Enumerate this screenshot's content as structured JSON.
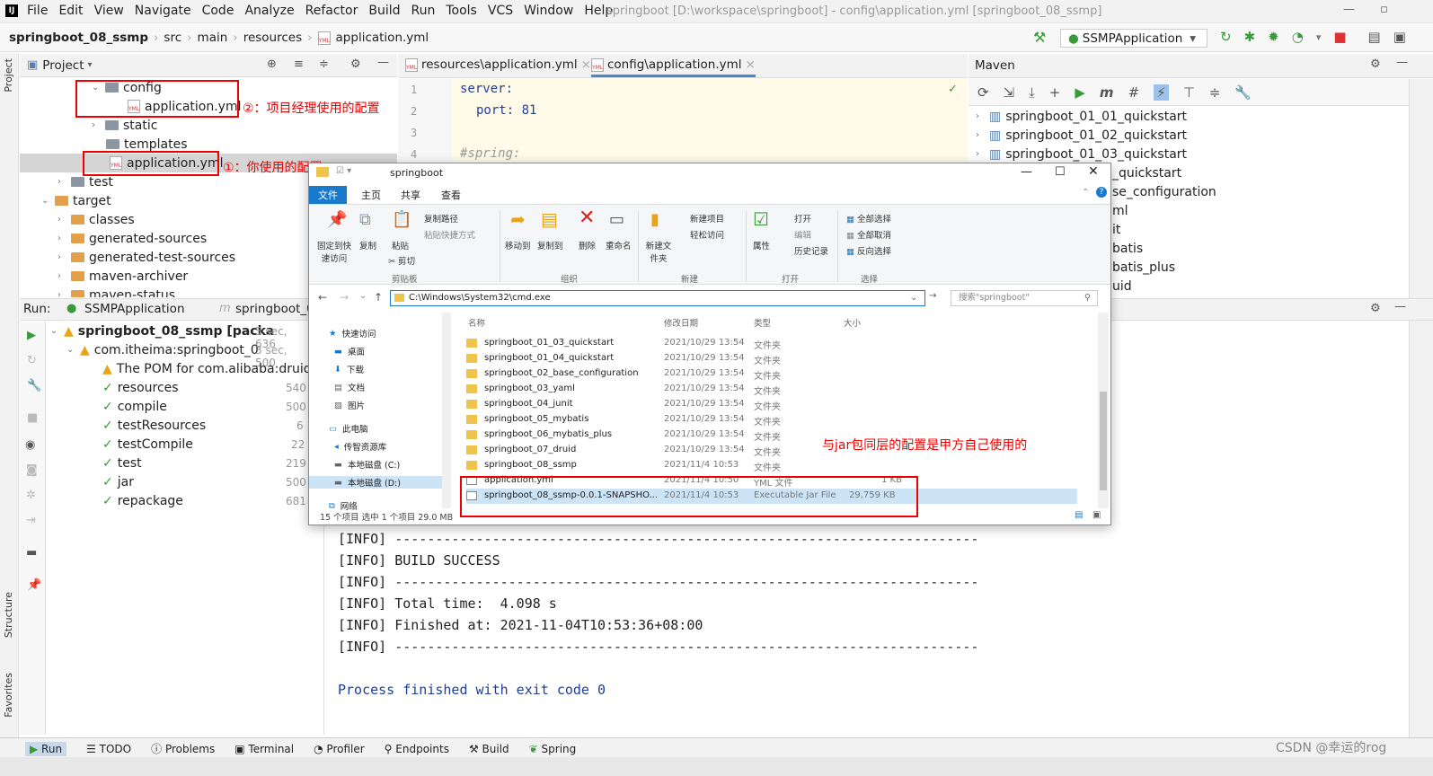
{
  "menubar": {
    "items": [
      "File",
      "Edit",
      "View",
      "Navigate",
      "Code",
      "Analyze",
      "Refactor",
      "Build",
      "Run",
      "Tools",
      "VCS",
      "Window",
      "Help"
    ],
    "title": "springboot [D:\\workspace\\springboot] - config\\application.yml [springboot_08_ssmp]"
  },
  "navbar": {
    "crumbs": [
      "springboot_08_ssmp",
      "src",
      "main",
      "resources",
      "application.yml"
    ],
    "run_config": "SSMPApplication"
  },
  "project": {
    "header": "Project",
    "tree": {
      "config": "config",
      "config_app": "application.yml",
      "static": "static",
      "templates": "templates",
      "res_app": "application.yml",
      "test": "test",
      "target": "target",
      "classes": "classes",
      "gen_sources": "generated-sources",
      "gen_test_sources": "generated-test-sources",
      "maven_archiver": "maven-archiver",
      "maven_status": "maven-status"
    },
    "note_config": "②：项目经理使用的配置",
    "note_resources": "①：你使用的配置"
  },
  "editor": {
    "tabs": [
      "resources\\application.yml",
      "config\\application.yml"
    ],
    "lines": [
      "1",
      "2",
      "3",
      "4"
    ],
    "code": {
      "l1": "server:",
      "l2": "port: 81",
      "l4": "#spring:"
    }
  },
  "maven": {
    "header": "Maven",
    "projects": [
      "springboot_01_01_quickstart",
      "springboot_01_02_quickstart",
      "springboot_01_03_quickstart",
      "_quickstart",
      "se_configuration",
      "ml",
      "it",
      "batis",
      "batis_plus",
      "uid"
    ]
  },
  "run": {
    "label": "Run:",
    "tab1": "SSMPApplication",
    "tab2": "springboot_0",
    "tree": [
      {
        "text": "springboot_08_ssmp [packa",
        "dur": "5 sec, 636"
      },
      {
        "text": "com.itheima:springboot_0",
        "dur": "3 sec, 500"
      },
      {
        "text": "The POM for com.alibaba:druid:ja",
        "dur": ""
      },
      {
        "text": "resources",
        "dur": "540"
      },
      {
        "text": "compile",
        "dur": "500"
      },
      {
        "text": "testResources",
        "dur": "6"
      },
      {
        "text": "testCompile",
        "dur": "22"
      },
      {
        "text": "test",
        "dur": "219"
      },
      {
        "text": "jar",
        "dur": "500"
      },
      {
        "text": "repackage",
        "dur": "681"
      }
    ],
    "console": [
      "[INFO] ------------------------------------------------------------------------",
      "[INFO] BUILD SUCCESS",
      "[INFO] ------------------------------------------------------------------------",
      "[INFO] Total time:  4.098 s",
      "[INFO] Finished at: 2021-11-04T10:53:36+08:00",
      "[INFO] ------------------------------------------------------------------------",
      "",
      "Process finished with exit code 0"
    ]
  },
  "statusbar": {
    "items": [
      "Run",
      "TODO",
      "Problems",
      "Terminal",
      "Profiler",
      "Endpoints",
      "Build",
      "Spring"
    ]
  },
  "stripe": {
    "project": "Project",
    "structure": "Structure",
    "favorites": "Favorites"
  },
  "explorer": {
    "title": "springboot",
    "tabs": [
      "文件",
      "主页",
      "共享",
      "查看"
    ],
    "ribbon": {
      "pin": "固定到快速访问",
      "copy": "复制",
      "paste": "粘贴",
      "copy_path": "复制路径",
      "paste_shortcut": "粘贴快捷方式",
      "cut": "剪切",
      "move_to": "移动到",
      "copy_to": "复制到",
      "delete": "删除",
      "rename": "重命名",
      "new_folder": "新建文件夹",
      "new_item": "新建项目",
      "easy_access": "轻松访问",
      "properties": "属性",
      "open": "打开",
      "edit": "编辑",
      "history": "历史记录",
      "select_all": "全部选择",
      "select_none": "全部取消",
      "invert": "反向选择",
      "groups": [
        "剪贴板",
        "组织",
        "新建",
        "打开",
        "选择"
      ]
    },
    "address": "C:\\Windows\\System32\\cmd.exe",
    "search_placeholder": "搜索\"springboot\"",
    "nav": [
      "快速访问",
      "桌面",
      "下载",
      "文档",
      "图片",
      "此电脑",
      "传智资源库",
      "本地磁盘 (C:)",
      "本地磁盘 (D:)",
      "网络"
    ],
    "columns": [
      "名称",
      "修改日期",
      "类型",
      "大小"
    ],
    "files": [
      {
        "name": "springboot_01_03_quickstart",
        "date": "2021/10/29 13:54",
        "type": "文件夹",
        "size": ""
      },
      {
        "name": "springboot_01_04_quickstart",
        "date": "2021/10/29 13:54",
        "type": "文件夹",
        "size": ""
      },
      {
        "name": "springboot_02_base_configuration",
        "date": "2021/10/29 13:54",
        "type": "文件夹",
        "size": ""
      },
      {
        "name": "springboot_03_yaml",
        "date": "2021/10/29 13:54",
        "type": "文件夹",
        "size": ""
      },
      {
        "name": "springboot_04_junit",
        "date": "2021/10/29 13:54",
        "type": "文件夹",
        "size": ""
      },
      {
        "name": "springboot_05_mybatis",
        "date": "2021/10/29 13:54",
        "type": "文件夹",
        "size": ""
      },
      {
        "name": "springboot_06_mybatis_plus",
        "date": "2021/10/29 13:54",
        "type": "文件夹",
        "size": ""
      },
      {
        "name": "springboot_07_druid",
        "date": "2021/10/29 13:54",
        "type": "文件夹",
        "size": ""
      },
      {
        "name": "springboot_08_ssmp",
        "date": "2021/11/4 10:53",
        "type": "文件夹",
        "size": ""
      },
      {
        "name": "application.yml",
        "date": "2021/11/4 10:50",
        "type": "YML 文件",
        "size": "1 KB"
      },
      {
        "name": "springboot_08_ssmp-0.0.1-SNAPSHO...",
        "date": "2021/11/4 10:53",
        "type": "Executable Jar File",
        "size": "29,759 KB"
      }
    ],
    "status": "15 个项目    选中 1 个项目  29.0 MB",
    "note": "与jar包同层的配置是甲方自己使用的"
  },
  "watermark": "CSDN @幸运的rog"
}
